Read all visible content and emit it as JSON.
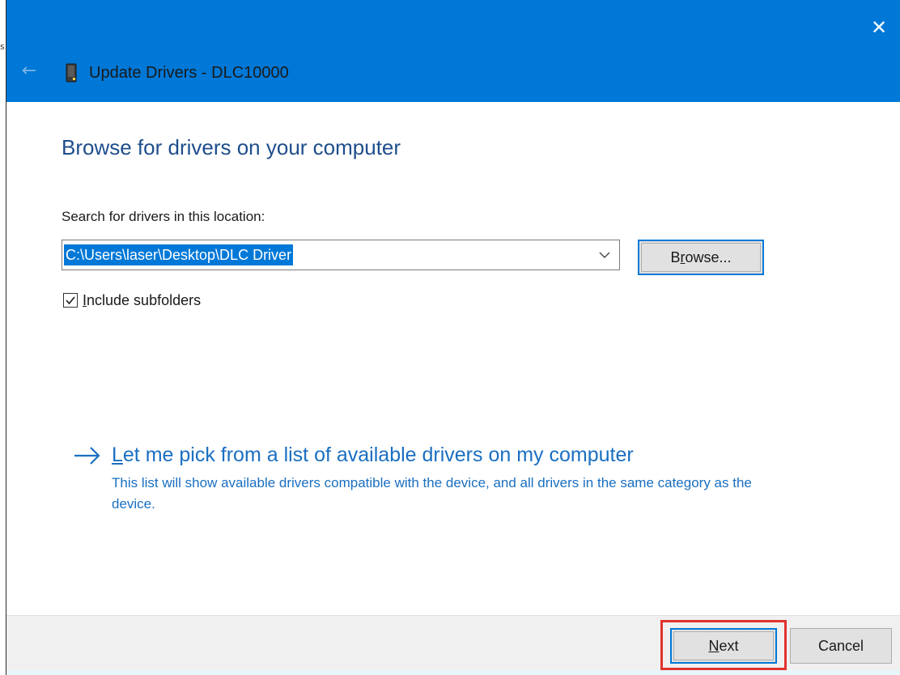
{
  "window": {
    "title": "Update Drivers - DLC10000",
    "stray_char": "s",
    "close_glyph": "✕",
    "back_glyph": "←"
  },
  "content": {
    "heading": "Browse for drivers on your computer",
    "search_label": "Search for drivers in this location:",
    "path_value": "C:\\Users\\laser\\Desktop\\DLC Driver",
    "browse_label_pre": "B",
    "browse_label_u": "r",
    "browse_label_post": "owse...",
    "include_subfolders": {
      "checked": true,
      "label_u": "I",
      "label_post": "nclude subfolders"
    },
    "pick_link_u": "L",
    "pick_link_post": "et me pick from a list of available drivers on my computer",
    "pick_description": "This list will show available drivers compatible with the device, and all drivers in the same category as the device."
  },
  "footer": {
    "next_label_u": "N",
    "next_label_post": "ext",
    "cancel_label": "Cancel"
  },
  "colors": {
    "titlebar": "#0078d7",
    "heading": "#1f4e8c",
    "link": "#1a6fc1",
    "highlight": "#e0322f"
  },
  "icons": {
    "back": "back-arrow-icon",
    "close": "close-icon",
    "device": "device-icon",
    "dropdown": "chevron-down-icon",
    "checkbox": "checkmark-icon",
    "link_arrow": "arrow-right-icon"
  }
}
